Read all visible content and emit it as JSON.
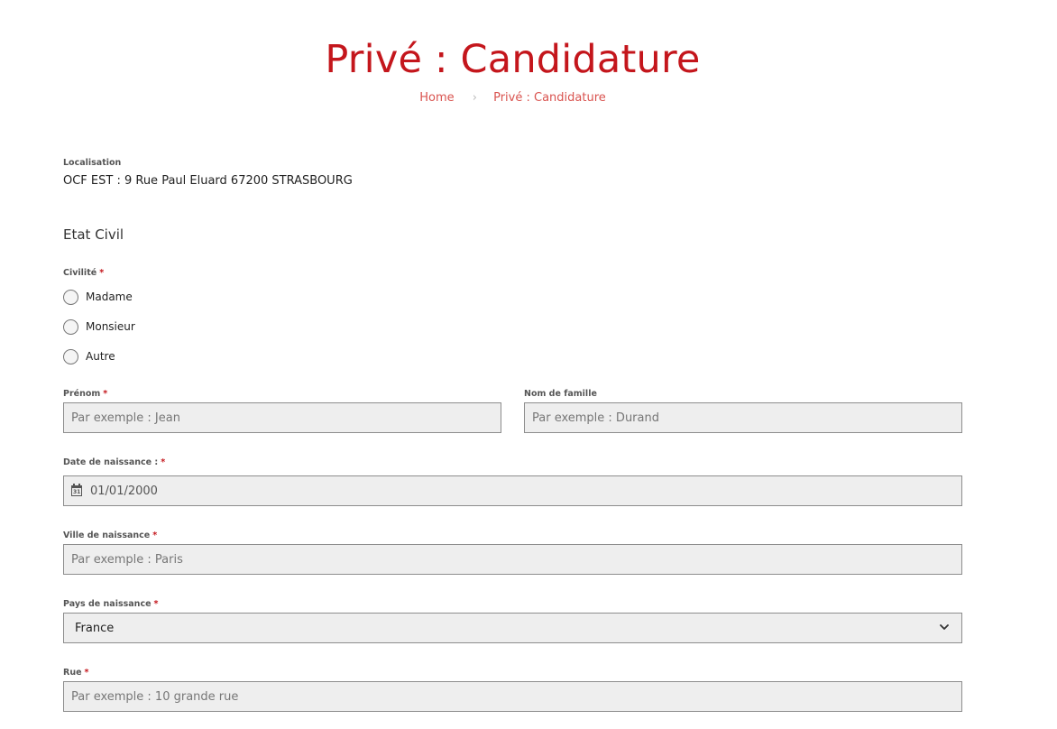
{
  "header": {
    "title": "Privé : Candidature",
    "breadcrumb": {
      "home": "Home",
      "separator": "›",
      "current": "Privé : Candidature"
    }
  },
  "location": {
    "label": "Localisation",
    "value": "OCF EST : 9 Rue Paul Eluard 67200 STRASBOURG"
  },
  "section": {
    "title": "Etat Civil"
  },
  "civility": {
    "label": "Civilité",
    "required": "*",
    "options": [
      "Madame",
      "Monsieur",
      "Autre"
    ]
  },
  "first_name": {
    "label": "Prénom",
    "required": "*",
    "placeholder": "Par exemple : Jean"
  },
  "last_name": {
    "label": "Nom de famille",
    "placeholder": "Par exemple : Durand"
  },
  "birth_date": {
    "label": "Date de naissance :",
    "required": "*",
    "value": "01/01/2000",
    "icon": "calendar-icon",
    "icon_day": "31"
  },
  "birth_city": {
    "label": "Ville de naissance",
    "required": "*",
    "placeholder": "Par exemple : Paris"
  },
  "birth_country": {
    "label": "Pays de naissance",
    "required": "*",
    "value": "France",
    "icon": "chevron-down-icon"
  },
  "street": {
    "label": "Rue",
    "required": "*",
    "placeholder": "Par exemple : 10 grande rue"
  },
  "colors": {
    "accent": "#c4161c",
    "breadcrumb": "#d9534f",
    "input_bg": "#eeeeee"
  }
}
